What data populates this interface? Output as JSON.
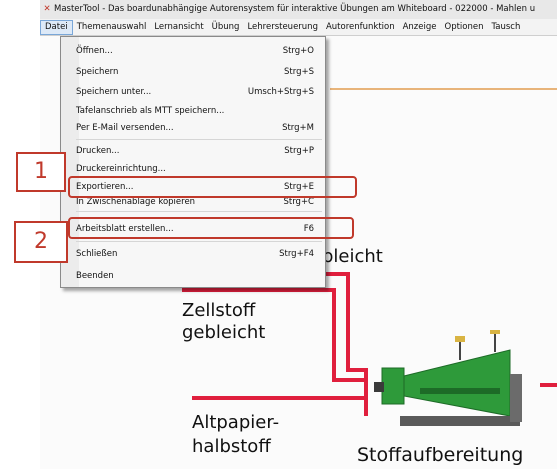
{
  "window": {
    "title": "MasterTool - Das boardunabhängige Autorensystem für interaktive Übungen am Whiteboard - 022000 - Mahlen u"
  },
  "menubar": {
    "items": [
      "Datei",
      "Themenauswahl",
      "Lernansicht",
      "Übung",
      "Lehrersteuerung",
      "Autorenfunktion",
      "Anzeige",
      "Optionen",
      "Tausch"
    ]
  },
  "file_menu": {
    "items": [
      {
        "label": "Öffnen...",
        "shortcut": "Strg+O"
      },
      {
        "label": "Speichern",
        "shortcut": "Strg+S"
      },
      {
        "label": "Speichern unter...",
        "shortcut": "Umsch+Strg+S"
      },
      {
        "label": "Tafelanschrieb als MTT speichern...",
        "shortcut": ""
      },
      {
        "label": "Per E-Mail versenden...",
        "shortcut": "Strg+M"
      },
      {
        "label": "Drucken...",
        "shortcut": "Strg+P"
      },
      {
        "label": "Druckereinrichtung...",
        "shortcut": ""
      },
      {
        "label": "Exportieren...",
        "shortcut": "Strg+E"
      },
      {
        "label": "In Zwischenablage kopieren",
        "shortcut": "Strg+C"
      },
      {
        "label": "Arbeitsblatt erstellen...",
        "shortcut": "F6"
      },
      {
        "label": "Schließen",
        "shortcut": "Strg+F4"
      },
      {
        "label": "Beenden",
        "shortcut": ""
      }
    ]
  },
  "callouts": {
    "one": "1",
    "two": "2"
  },
  "diagram": {
    "label_top": "bleicht",
    "label_zellstoff_1": "Zellstoff",
    "label_zellstoff_2": "gebleicht",
    "label_altpapier_1": "Altpapier-",
    "label_altpapier_2": "halbstoff",
    "label_stoffaufbereitung": "Stoffaufbereitung"
  },
  "colors": {
    "arrow": "#e01f3d",
    "callout": "#c0392b",
    "machine_green": "#2e9a3a"
  }
}
